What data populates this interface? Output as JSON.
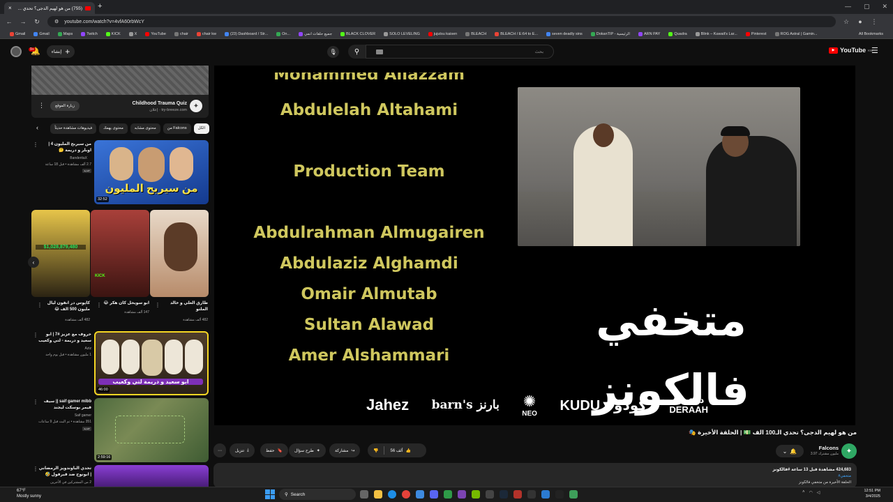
{
  "browser": {
    "tab_title": "(755) من هو لهيم الدجى؟ تحدي ...",
    "url": "youtube.com/watch?v=4vfA60rbWcY",
    "bookmarks": [
      "Gmail",
      "Gmail",
      "Maps",
      "Twitch",
      "KICK",
      "X",
      "YouTube",
      "chair",
      "chair kw",
      "(23) Dashboard / Str...",
      "On...",
      "جميع حلقات انمي",
      "BLACK CLOVER",
      "SOLO LEVELING",
      "jujutsu kaisen",
      "BLEACH",
      "BLEACH / E:64 to E...",
      "seven deadly sins",
      "DokanTIP - الرئيسية",
      "ARN PAY",
      "Quadra",
      "Blink – Kuwait's Lar...",
      "Pinterest",
      "ROG Astral | Gamin..."
    ],
    "all_bookmarks": "All Bookmarks"
  },
  "header": {
    "create_label": "إنشاء",
    "notif_count": "9+",
    "search_placeholder": "بحث",
    "logo_text": "YouTube",
    "logo_region": "KW"
  },
  "ad": {
    "title": "Childhood Trauma Quiz",
    "sponsor_label": "إعلان",
    "domain": "try-breeze.com",
    "visit_label": "زيارة الموقع"
  },
  "chips": [
    "الكل",
    "من Falcons",
    "محتوى مشابه",
    "محتوى يهمك",
    "فيديوهات مشاهدة حديثاً"
  ],
  "sidebar_videos": [
    {
      "title": "من سيربح المليون 4 | اوبلر و دريمة 🤔",
      "channel": "BanderitaX",
      "meta": "2.7 ألف مشاهدة • قبل 18 ساعة",
      "badge": "جديد",
      "duration": "32:52",
      "thumb_text": "من سيربح المليون"
    },
    {
      "title": "حروف مع عزيز #7 | ابو سعيد و دريمة - لتي وكعيب",
      "channel": "Aziz",
      "meta": "1 مليون مشاهدة • قبل يوم واحد",
      "badge": "",
      "duration": "46:00",
      "thumb_text": "ابو سعيد و دريمة لتي وكعيب"
    },
    {
      "title": "saif gamer mlbb || سيف قيمر بوسكت ليجند",
      "channel": "Saif gamer",
      "meta": "351 مشاهدة • تم البث قبل 9 ساعات",
      "badge": "جديد",
      "duration": "2:59:16",
      "thumb_text": ""
    },
    {
      "title": "تحدي الباوندويز الرمضاني | ابونوح ضد قيرفول 🤣",
      "channel": "عبد الله السعر",
      "meta": "2 من المشتركين في الأجرين",
      "badge": "",
      "duration": "",
      "thumb_text": ""
    }
  ],
  "shorts": [
    {
      "title": "طارق العلي و خالد الملتو",
      "meta": "482 ألف مشاهدة"
    },
    {
      "title": "ابو سويحل كان هكر 😂",
      "meta": "147 ألف مشاهدة"
    },
    {
      "title": "كاپوس در انفون ليال مليون 500 الف 😂",
      "meta": "482 ألف مشاهدة"
    }
  ],
  "short_kick_label": "KICK",
  "short_money_text": "$1,028,879,480",
  "player": {
    "credits_top_partial": "Mohammed Allazzam",
    "credit_1": "Abdulelah Altahami",
    "section_heading": "Production Team",
    "credit_2": "Abdulrahman Almugairen",
    "credit_3": "Abdulaziz Alghamdi",
    "credit_4": "Omair Almutab",
    "credit_5": "Sultan Alawad",
    "credit_6": "Amer Alshammari",
    "show_logo_arabic": "متخفي فالكونز",
    "sponsors": {
      "jahez": "Jahez",
      "barns": "barn's بارنز",
      "neo": "NEO",
      "kudu": "KUDU▼كودو",
      "deraah_ar": "درعـــه",
      "deraah_en": "DERAAH"
    }
  },
  "video": {
    "title": "من هو لهيم الدجى؟ تحدي الـ100 الف 💵 | الحلقة الأخيرة 🎭",
    "channel": "Falcons",
    "subscribers": "3.97 مليون مشترك",
    "likes": "56 ألف",
    "share_label": "مشاركة",
    "ask_label": "طرح سؤال",
    "save_label": "حفظ",
    "download_label": "تنزيل",
    "stats": "424,683 مشاهدة قبل 13 ساعة #فالكونز",
    "tags": "#متخفي",
    "desc_line": "الحلقة الأخيرة من متخفي فالكونز"
  },
  "taskbar": {
    "temp": "67°F",
    "weather": "Mostly sunny",
    "search_label": "Search",
    "time": "12:51 PM",
    "date": "3/4/2025"
  },
  "colors": {
    "credits_text": "#cfc75e",
    "yt_red": "#ff0000",
    "channel_green": "#2fa864"
  }
}
